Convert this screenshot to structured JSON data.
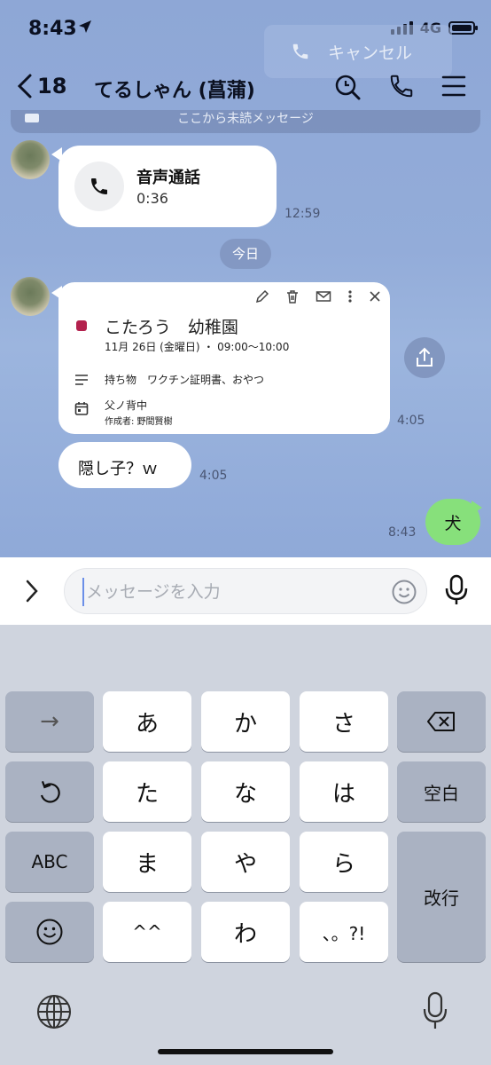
{
  "status": {
    "time": "8:43",
    "network": "4G"
  },
  "cancel_overlay": {
    "label": "キャンセル"
  },
  "header": {
    "back_count": "18",
    "title": "てるしゃん (菖蒲)"
  },
  "unread": {
    "label": "ここから未読メッセージ"
  },
  "messages": {
    "call": {
      "title": "音声通話",
      "duration": "0:36",
      "time": "12:59"
    },
    "date_separator": "今日",
    "event": {
      "title": "こたろう　幼稚園",
      "date": "11月 26日 (金曜日) ・ 09:00〜10:00",
      "description": "持ち物　ワクチン証明書、おやつ",
      "calendar": "父ノ背中",
      "organizer": "作成者: 野間賢樹",
      "time": "4:05"
    },
    "reply": {
      "text": "隠し子？ｗ",
      "time": "4:05"
    },
    "mine": {
      "text": "犬",
      "time": "8:43"
    }
  },
  "input": {
    "placeholder": "メッセージを入力",
    "value": ""
  },
  "keyboard": {
    "row1": [
      "→",
      "あ",
      "か",
      "さ"
    ],
    "row2": [
      "た",
      "な",
      "は",
      "空白"
    ],
    "row3": [
      "ABC",
      "ま",
      "や",
      "ら"
    ],
    "row4": [
      "^^",
      "わ",
      "、。?!"
    ],
    "enter": "改行"
  }
}
